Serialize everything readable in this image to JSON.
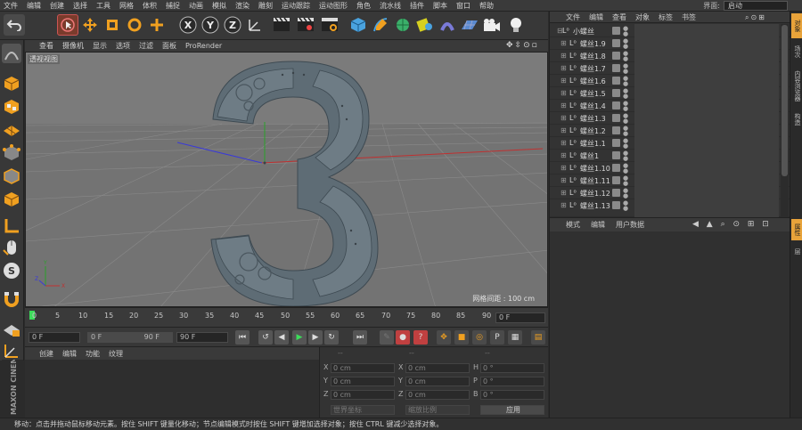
{
  "menubar": {
    "items": [
      "文件",
      "编辑",
      "创建",
      "选择",
      "工具",
      "网格",
      "体积",
      "捕捉",
      "动画",
      "模拟",
      "渲染",
      "雕刻",
      "运动跟踪",
      "运动图形",
      "角色",
      "流水线",
      "插件",
      "脚本",
      "窗口",
      "帮助"
    ],
    "layout_label": "界面:",
    "layout_value": "启动"
  },
  "viewport": {
    "menu": [
      "查看",
      "摄像机",
      "显示",
      "选项",
      "过滤",
      "面板",
      "ProRender"
    ],
    "label": "透视视图",
    "grid_spacing": "网格间距 : 100 cm"
  },
  "timeline": {
    "ticks": [
      "0",
      "5",
      "10",
      "15",
      "20",
      "25",
      "30",
      "35",
      "40",
      "45",
      "50",
      "55",
      "60",
      "65",
      "70",
      "75",
      "80",
      "85",
      "90"
    ],
    "end_field": "0 F"
  },
  "playbar": {
    "start": "0 F",
    "range_start": "0 F",
    "range_end": "90 F",
    "end": "90 F"
  },
  "material_panel": {
    "menu": [
      "创建",
      "编辑",
      "功能",
      "纹理"
    ]
  },
  "coords": {
    "headers": [
      "--",
      "--",
      "--"
    ],
    "rows": [
      {
        "a": "X",
        "av": "0 cm",
        "b": "X",
        "bv": "0 cm",
        "c": "H",
        "cv": "0 °"
      },
      {
        "a": "Y",
        "av": "0 cm",
        "b": "Y",
        "bv": "0 cm",
        "c": "P",
        "cv": "0 °"
      },
      {
        "a": "Z",
        "av": "0 cm",
        "b": "Z",
        "bv": "0 cm",
        "c": "B",
        "cv": "0 °"
      }
    ],
    "world_select": "世界坐标",
    "scale_select": "缩放比例",
    "apply_button": "应用"
  },
  "object_manager": {
    "menu": [
      "文件",
      "编辑",
      "查看",
      "对象",
      "标签",
      "书签"
    ],
    "root": "小螺丝",
    "objects": [
      "螺丝1.9",
      "螺丝1.8",
      "螺丝1.7",
      "螺丝1.6",
      "螺丝1.5",
      "螺丝1.4",
      "螺丝1.3",
      "螺丝1.2",
      "螺丝1.1",
      "螺丝1",
      "螺丝1.10",
      "螺丝1.11",
      "螺丝1.12",
      "螺丝1.13"
    ]
  },
  "attributes": {
    "menu": [
      "模式",
      "编辑",
      "用户数据"
    ]
  },
  "side_tabs": [
    "对象",
    "场次",
    "内容浏览器",
    "构造"
  ],
  "side_tab_attr": "属性",
  "side_tab_layer": "层",
  "status": "移动：点击并拖动鼠标移动元素。按住 SHIFT 键量化移动；节点编辑模式时按住 SHIFT 键增加选择对象；按住 CTRL 键减少选择对象。",
  "logo_text": "MAXON CINEMA 4D",
  "colors": {
    "accent": "#e8a33a",
    "viewport_bg": "#7b7b7b",
    "panel_bg": "#333333",
    "model": "#5d6b74"
  }
}
